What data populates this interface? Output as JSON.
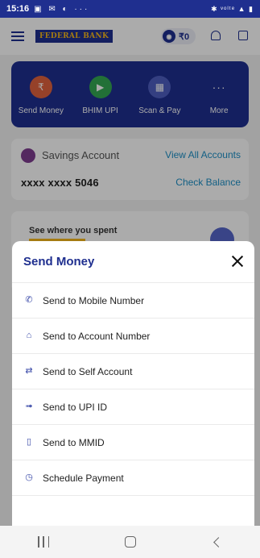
{
  "status_bar": {
    "time": "15:16",
    "left_icons": "▣ ✉ ◐ ···",
    "right_icons": "✱ ᵛᵒˡᵗᵉ ▲ ▮"
  },
  "header": {
    "logo_text": "FEDERAL BANK",
    "rewards_icon": "coin-icon",
    "rewards_value": "₹0"
  },
  "quick_actions": [
    {
      "label": "Send Money",
      "icon": "send-money-icon"
    },
    {
      "label": "BHIM UPI",
      "icon": "play-icon"
    },
    {
      "label": "Scan & Pay",
      "icon": "qr-icon"
    },
    {
      "label": "More",
      "icon": "dots-icon"
    }
  ],
  "savings": {
    "account_type": "Savings Account",
    "view_all": "View All Accounts",
    "account_number": "xxxx xxxx 5046",
    "check_balance": "Check Balance"
  },
  "spend_card": {
    "title": "See where you spent"
  },
  "sheet": {
    "title": "Send Money",
    "items": [
      {
        "label": "Send to Mobile Number",
        "icon": "phone-icon",
        "glyph": "✆"
      },
      {
        "label": "Send to Account Number",
        "icon": "bank-icon",
        "glyph": "⌂"
      },
      {
        "label": "Send to Self Account",
        "icon": "transfer-icon",
        "glyph": "⇄"
      },
      {
        "label": "Send to UPI ID",
        "icon": "upi-icon",
        "glyph": "➟"
      },
      {
        "label": "Send to MMID",
        "icon": "mobile-icon",
        "glyph": "▯"
      },
      {
        "label": "Schedule Payment",
        "icon": "clock-icon",
        "glyph": "◷"
      }
    ]
  },
  "colors": {
    "primary": "#1f2f8f",
    "link": "#1d8fc6",
    "accent": "#f6b81a"
  }
}
